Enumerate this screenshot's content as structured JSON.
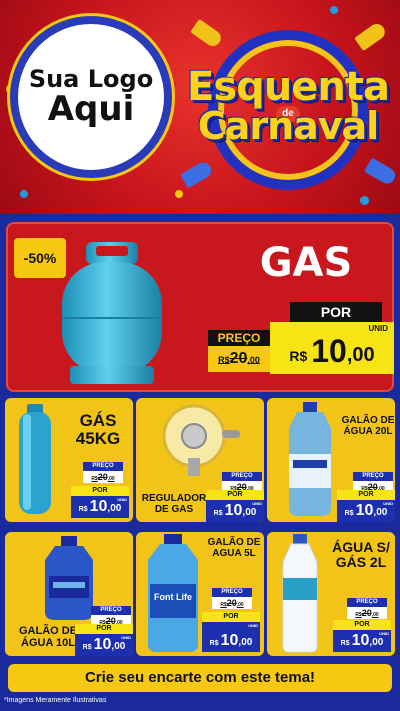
{
  "header": {
    "logo_line1": "Sua Logo",
    "logo_line2": "Aqui",
    "theme_top": "Esquenta",
    "theme_mid": "de",
    "theme_bottom": "Carnaval"
  },
  "featured": {
    "discount": "-50%",
    "title": "GAS",
    "por_label": "POR",
    "preco_label": "PREÇO",
    "old_currency": "R$",
    "old_int": "20",
    "old_dec": ",00",
    "new_currency": "R$",
    "new_int": "10",
    "new_dec": ",00",
    "unit": "UNID"
  },
  "products": [
    {
      "name": "GÁS 45KG",
      "preco_label": "PREÇO",
      "old_currency": "R$",
      "old_int": "20",
      "old_dec": ",00",
      "por_label": "POR",
      "currency": "R$",
      "int": "10",
      "dec": ",00",
      "unit": "UNID"
    },
    {
      "name": "REGULADOR DE GAS",
      "preco_label": "PREÇO",
      "old_currency": "R$",
      "old_int": "20",
      "old_dec": ",00",
      "por_label": "POR",
      "currency": "R$",
      "int": "10",
      "dec": ",00",
      "unit": "UNID"
    },
    {
      "name": "GALÃO DE ÁGUA 20L",
      "preco_label": "PREÇO",
      "old_currency": "R$",
      "old_int": "20",
      "old_dec": ",00",
      "por_label": "POR",
      "currency": "R$",
      "int": "10",
      "dec": ",00",
      "unit": "UNID"
    },
    {
      "name": "GALÃO DE ÁGUA 10L",
      "preco_label": "PREÇO",
      "old_currency": "R$",
      "old_int": "20",
      "old_dec": ",00",
      "por_label": "POR",
      "currency": "R$",
      "int": "10",
      "dec": ",00",
      "unit": "UNID"
    },
    {
      "name": "GALÃO DE AGUA 5L",
      "preco_label": "PREÇO",
      "old_currency": "R$",
      "old_int": "20",
      "old_dec": ",00",
      "por_label": "POR",
      "currency": "R$",
      "int": "10",
      "dec": ",00",
      "unit": "UNID"
    },
    {
      "name": "ÁGUA S/ GÁS 2L",
      "preco_label": "PREÇO",
      "old_currency": "R$",
      "old_int": "20",
      "old_dec": ",00",
      "por_label": "POR",
      "currency": "R$",
      "int": "10",
      "dec": ",00",
      "unit": "UNID"
    }
  ],
  "bottle_labels": {
    "font_life": "Font Life"
  },
  "cta": "Crie seu encarte com este tema!",
  "footnote": "*Imagens Meramente Ilustrativas",
  "colors": {
    "red": "#c8171d",
    "yellow": "#f2c418",
    "blue": "#1c2fae",
    "background": "#1a2a9c"
  }
}
